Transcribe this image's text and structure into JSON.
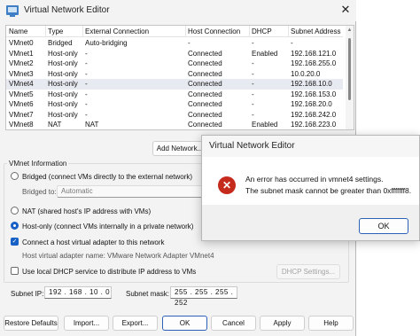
{
  "window": {
    "title": "Virtual Network Editor",
    "close_glyph": "✕"
  },
  "table": {
    "headers": [
      "Name",
      "Type",
      "External Connection",
      "Host Connection",
      "DHCP",
      "Subnet Address"
    ],
    "rows": [
      [
        "VMnet0",
        "Bridged",
        "Auto-bridging",
        "-",
        "-",
        "-"
      ],
      [
        "VMnet1",
        "Host-only",
        "-",
        "Connected",
        "Enabled",
        "192.168.121.0"
      ],
      [
        "VMnet2",
        "Host-only",
        "-",
        "Connected",
        "-",
        "192.168.255.0"
      ],
      [
        "VMnet3",
        "Host-only",
        "-",
        "Connected",
        "-",
        "10.0.20.0"
      ],
      [
        "VMnet4",
        "Host-only",
        "-",
        "Connected",
        "-",
        "192.168.10.0"
      ],
      [
        "VMnet5",
        "Host-only",
        "-",
        "Connected",
        "-",
        "192.168.153.0"
      ],
      [
        "VMnet6",
        "Host-only",
        "-",
        "Connected",
        "-",
        "192.168.20.0"
      ],
      [
        "VMnet7",
        "Host-only",
        "-",
        "Connected",
        "-",
        "192.168.242.0"
      ],
      [
        "VMnet8",
        "NAT",
        "NAT",
        "Connected",
        "Enabled",
        "192.168.223.0"
      ]
    ],
    "selected_index": 4,
    "scroll_up_glyph": "▲"
  },
  "table_buttons": {
    "add_network": "Add Network..."
  },
  "vmnet_info": {
    "group_title": "VMnet Information",
    "bridged_label": "Bridged (connect VMs directly to the external network)",
    "bridged_to_label": "Bridged to:",
    "bridged_to_value": "Automatic",
    "nat_label": "NAT (shared host's IP address with VMs)",
    "hostonly_label": "Host-only (connect VMs internally in a private network)",
    "selected_mode": "Host-only",
    "connect_adapter_label": "Connect a host virtual adapter to this network",
    "connect_adapter_checked": true,
    "adapter_name_label": "Host virtual adapter name: VMware Network Adapter VMnet4",
    "dhcp_label": "Use local DHCP service to distribute IP address to VMs",
    "dhcp_checked": false,
    "dhcp_settings_button": "DHCP Settings...",
    "check_glyph": "✓"
  },
  "subnet": {
    "ip_label": "Subnet IP:",
    "ip_value": "192 . 168 . 10  .  0",
    "mask_label": "Subnet mask:",
    "mask_value": "255 . 255 . 255 . 252"
  },
  "bottom_buttons": {
    "restore": "Restore Defaults",
    "import": "Import...",
    "export": "Export...",
    "ok": "OK",
    "cancel": "Cancel",
    "apply": "Apply",
    "help": "Help"
  },
  "dialog": {
    "title": "Virtual Network Editor",
    "icon_glyph": "✕",
    "message_line1": "An error has occurred in vmnet4 settings.",
    "message_line2": "The subnet mask cannot be greater than 0xfffffff8.",
    "ok_button": "OK"
  },
  "colors": {
    "accent": "#1660c6",
    "error": "#c42b1c",
    "selected_row": "#e7eaf0"
  }
}
